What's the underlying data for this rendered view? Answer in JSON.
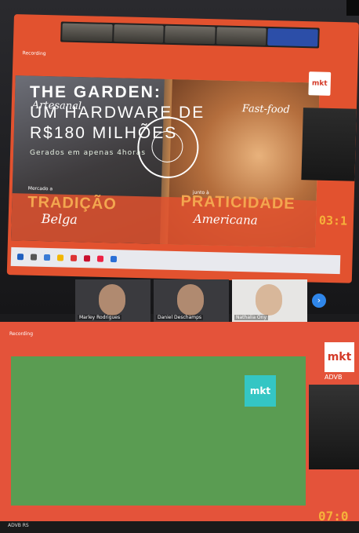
{
  "top_screen": {
    "recording_label": "Recording",
    "slide": {
      "left_script": "Artesanal",
      "right_script": "Fast-food",
      "left_caption": "Mercado a",
      "right_caption": "junto à",
      "word_left": "TRADIÇÃO",
      "word_left_script": "Belga",
      "word_right": "PRATICIDADE",
      "word_right_script": "Americana"
    },
    "badge": "mkt",
    "timer": "03:1"
  },
  "participants": [
    {
      "name": "Marley Rodrigues"
    },
    {
      "name": "Daniel Deschamps"
    },
    {
      "name": "Nathalia Ony"
    }
  ],
  "bottom_screen": {
    "recording_label": "Recording",
    "slide": {
      "title": "THE GARDEN:",
      "line2": "UM HARDWARE DE",
      "line3": "R$180 MILHÕES",
      "subtitle": "Gerados em apenas 4horas",
      "card": "mkt"
    },
    "badge": "mkt",
    "advb": "ADVB",
    "timer": "07:0",
    "footer": "ADVB RS"
  },
  "colors": {
    "accent": "#e2522f",
    "timer": "#f6b13a",
    "slide_green": "#5a9c52"
  }
}
